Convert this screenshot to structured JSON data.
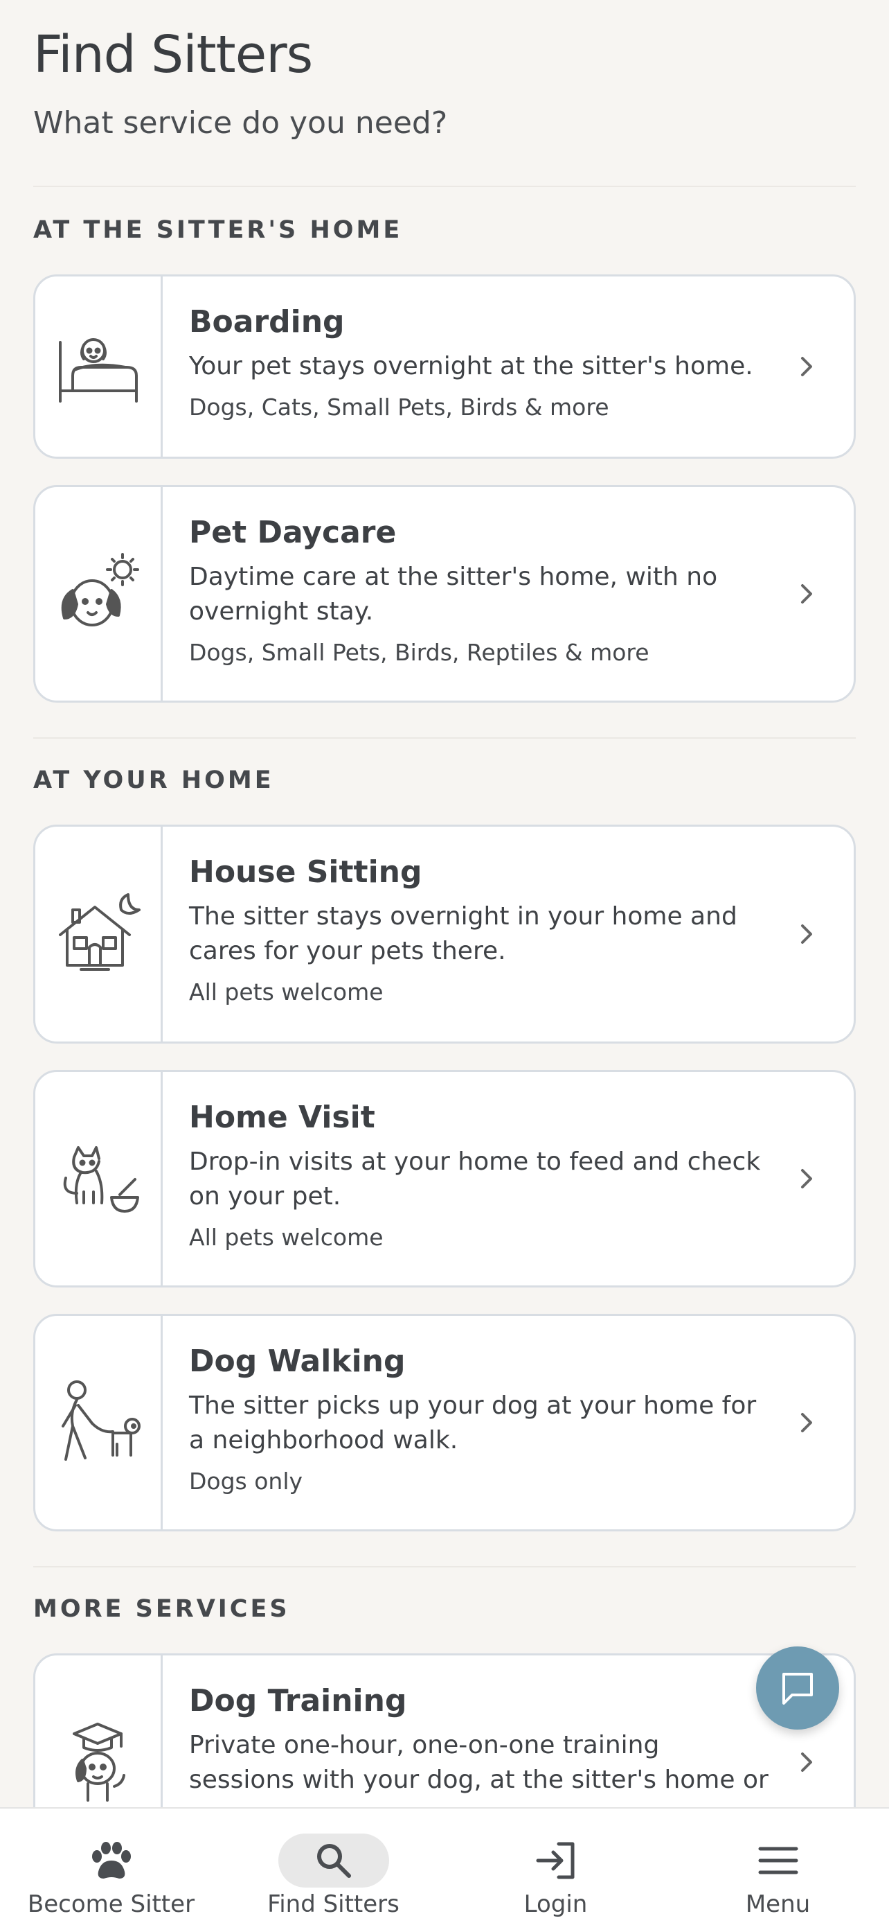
{
  "header": {
    "title": "Find Sitters",
    "subtitle": "What service do you need?"
  },
  "sections": [
    {
      "label": "AT THE SITTER'S HOME",
      "cards": [
        {
          "name": "Boarding",
          "desc": "Your pet stays overnight at the sitter's home.",
          "pets": "Dogs, Cats, Small Pets, Birds & more",
          "icon": "dog-in-bed-icon"
        },
        {
          "name": "Pet Daycare",
          "desc": "Daytime care at the sitter's home, with no overnight stay.",
          "pets": "Dogs, Small Pets, Birds, Reptiles & more",
          "icon": "dog-sun-icon"
        }
      ]
    },
    {
      "label": "AT YOUR HOME",
      "cards": [
        {
          "name": "House Sitting",
          "desc": "The sitter stays overnight in your home and cares for your pets there.",
          "pets": "All pets welcome",
          "icon": "house-moon-icon"
        },
        {
          "name": "Home Visit",
          "desc": "Drop-in visits at your home to feed and check on your pet.",
          "pets": "All pets welcome",
          "icon": "cat-bowl-icon"
        },
        {
          "name": "Dog Walking",
          "desc": "The sitter picks up your dog at your home for a neighborhood walk.",
          "pets": "Dogs only",
          "icon": "person-walking-dog-icon"
        }
      ]
    },
    {
      "label": "MORE SERVICES",
      "cards": [
        {
          "name": "Dog Training",
          "desc": "Private one-hour, one-on-one training sessions with your dog, at the sitter's home or yours.",
          "pets": "",
          "icon": "dog-graduate-icon"
        }
      ]
    }
  ],
  "tabbar": {
    "items": [
      {
        "label": "Become Sitter",
        "icon": "paw-icon"
      },
      {
        "label": "Find Sitters",
        "icon": "search-icon",
        "active": true
      },
      {
        "label": "Login",
        "icon": "login-icon"
      },
      {
        "label": "Menu",
        "icon": "menu-icon"
      }
    ]
  },
  "colors": {
    "background": "#f7f5f2",
    "card_border": "#d8dde3",
    "fab": "#6e9bb2",
    "text": "#404347"
  }
}
